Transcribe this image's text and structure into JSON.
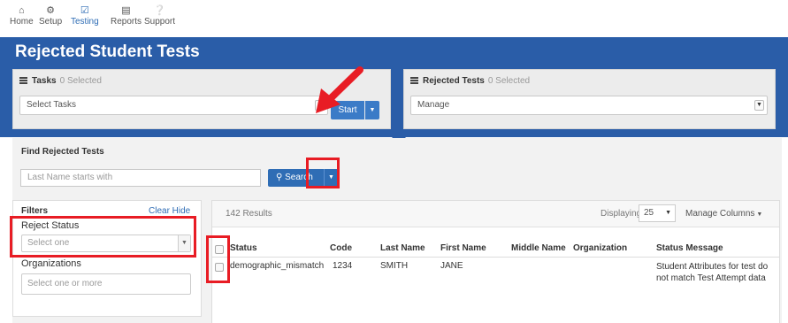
{
  "nav": {
    "items": [
      {
        "label": "Home",
        "icon": "home-icon",
        "active": false
      },
      {
        "label": "Setup",
        "icon": "gear-icon",
        "active": false
      },
      {
        "label": "Testing",
        "icon": "check-icon",
        "active": true
      },
      {
        "label": "Reports",
        "icon": "reports-icon",
        "active": false
      },
      {
        "label": "Support",
        "icon": "help-icon",
        "active": false
      }
    ]
  },
  "page_title": "Rejected Student Tests",
  "tasks_panel": {
    "title": "Tasks",
    "selected": "0 Selected",
    "select_value": "Select Tasks",
    "start_label": "Start"
  },
  "rejected_panel": {
    "title": "Rejected Tests",
    "selected": "0 Selected",
    "select_value": "Manage"
  },
  "find": {
    "title": "Find Rejected Tests",
    "placeholder": "Last Name starts with",
    "search_label": "Search"
  },
  "filters": {
    "title": "Filters",
    "clear_hide": "Clear  Hide",
    "reject_status_label": "Reject Status",
    "reject_status_placeholder": "Select one",
    "organizations_label": "Organizations",
    "organizations_placeholder": "Select one or more"
  },
  "results": {
    "count": "142 Results",
    "displaying_label": "Displaying",
    "page_size": "25",
    "manage_columns": "Manage Columns"
  },
  "table": {
    "headers": [
      "Status",
      "Code",
      "Last Name",
      "First Name",
      "Middle Name",
      "Organization",
      "Status Message"
    ],
    "rows": [
      {
        "status": "demographic_mismatch",
        "code": "1234",
        "last_name": "SMITH",
        "first_name": "JANE",
        "middle_name": "",
        "organization": "",
        "status_message": "Student Attributes for test do not match Test Attempt data"
      }
    ]
  },
  "colors": {
    "banner": "#2a5da8",
    "button_blue": "#2f6db5",
    "annotation_red": "#e81c24"
  }
}
